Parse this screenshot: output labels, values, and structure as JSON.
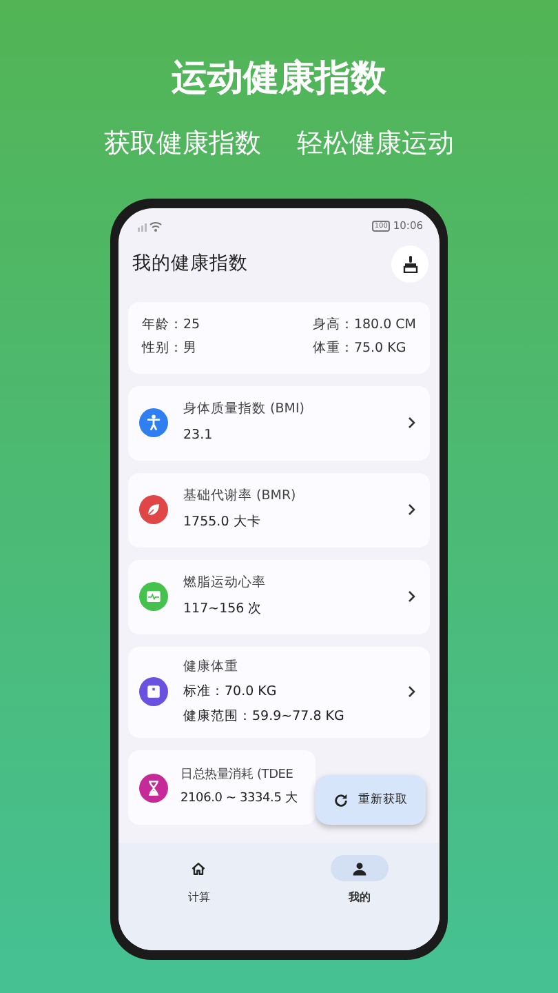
{
  "headline": "运动健康指数",
  "subheadlines": [
    "获取健康指数",
    "轻松健康运动"
  ],
  "status_bar": {
    "battery": "100",
    "time": "10:06"
  },
  "app_bar": {
    "title": "我的健康指数"
  },
  "profile": [
    "年龄：25",
    "身高：180.0 CM",
    "性别：男",
    "体重：75.0 KG"
  ],
  "metrics": [
    {
      "kind": "bmi",
      "color": "#2f7ff0",
      "title": "身体质量指数 (BMI)",
      "lines": [
        "23.1"
      ],
      "chevron": true
    },
    {
      "kind": "bmr",
      "color": "#e04646",
      "title": "基础代谢率 (BMR)",
      "lines": [
        "1755.0 大卡"
      ],
      "chevron": true
    },
    {
      "kind": "heart",
      "color": "#45c14d",
      "title": "燃脂运动心率",
      "lines": [
        "117~156 次"
      ],
      "chevron": true
    },
    {
      "kind": "weight",
      "color": "#6a51e0",
      "title": "健康体重",
      "lines": [
        "标准：70.0 KG",
        "健康范围：59.9~77.8 KG"
      ],
      "chevron": true
    },
    {
      "kind": "tdee",
      "color": "#c52a98",
      "title": "日总热量消耗 (TDEE",
      "lines": [
        "2106.0 ~ 3334.5 大"
      ],
      "chevron": false
    }
  ],
  "fab": {
    "label": "重新获取"
  },
  "nav": [
    {
      "kind": "home",
      "label": "计算",
      "selected": false
    },
    {
      "kind": "person",
      "label": "我的",
      "selected": true
    }
  ]
}
